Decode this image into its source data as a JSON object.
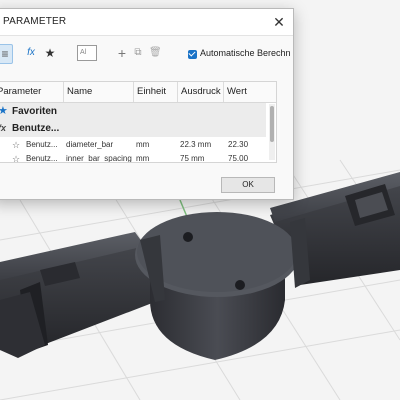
{
  "dialog": {
    "title": "PARAMETER",
    "close_glyph": "✕",
    "toolbar": {
      "filter_icon": "filter-icon",
      "fx_label": "fx",
      "favorite_icon": "star-icon",
      "search_placeholder": "Al",
      "add_glyph": "+",
      "auto_compute_label": "Automatische Berechn",
      "auto_compute_checked": true
    },
    "table": {
      "headers": [
        "Parameter",
        "Name",
        "Einheit",
        "Ausdruck",
        "Wert"
      ],
      "groups": [
        {
          "icon": "★",
          "label": "Favoriten"
        },
        {
          "icon": "fx",
          "label": "Benutze..."
        }
      ],
      "rows": [
        {
          "parameter": "Benutz...",
          "name": "diameter_bar",
          "unit": "mm",
          "expression": "22.3 mm",
          "value": "22.30"
        },
        {
          "parameter": "Benutz...",
          "name": "inner_bar_spacing",
          "unit": "mm",
          "expression": "75 mm",
          "value": "75.00"
        }
      ]
    },
    "ok_label": "OK"
  },
  "colors": {
    "accent": "#1a73c7",
    "model_dark": "#3a3c42",
    "model_light": "#565961"
  }
}
